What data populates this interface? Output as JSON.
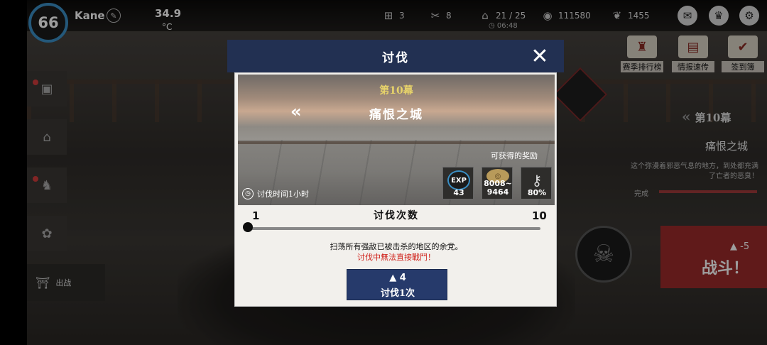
{
  "player": {
    "level": "66",
    "name": "Kane"
  },
  "weather": {
    "temperature": "34.9",
    "unit": "°C"
  },
  "resources": {
    "bed": "3",
    "tools": "8",
    "energy": "21 / 25",
    "energy_timer": "06:48",
    "coins": "111580",
    "gems": "1455"
  },
  "right_menu": {
    "ranking": "赛季排行榜",
    "report": "情报速传",
    "checkin": "签到簿"
  },
  "side": {
    "depart": "出战"
  },
  "right_panel": {
    "chapter": "第10幕",
    "stage": "痛恨之城",
    "description": "这个弥漫着邪恶气息的地方，到处都充满了亡者的恶臭！",
    "complete": "完成",
    "fight_cost": "-5",
    "fight": "战斗！"
  },
  "modal": {
    "title": "讨伐",
    "chapter": "第10幕",
    "stage": "痛恨之城",
    "reward_title": "可获得的奖励",
    "rewards": {
      "exp_icon": "EXP",
      "exp": "43",
      "coin_min": "8008~",
      "coin_max": "9464",
      "key_percent": "80%"
    },
    "duration": "讨伐时间1小时",
    "count_label": "讨伐次数",
    "count_min": "1",
    "count_max": "10",
    "count_selected": 1,
    "info_line1": "扫荡所有强敌已被击杀的地区的余党。",
    "info_line2": "讨伐中無法直接戰鬥！",
    "sweep_cost": "4",
    "sweep_label": "讨伐1次"
  },
  "colors": {
    "header": "#223052",
    "button": "#263a6b",
    "warning": "#d0221b",
    "chapter_gold": "#e7d36a",
    "level_ring": "#3a8fc5"
  },
  "icons": [
    "pencil-icon",
    "bed-icon",
    "tools-icon",
    "energy-icon",
    "clock-icon",
    "coin-icon",
    "gem-icon",
    "mail-icon",
    "achievement-icon",
    "settings-icon",
    "gift-icon",
    "shop-icon",
    "stopwatch-icon",
    "key-icon",
    "onigiri-icon",
    "close-icon"
  ]
}
